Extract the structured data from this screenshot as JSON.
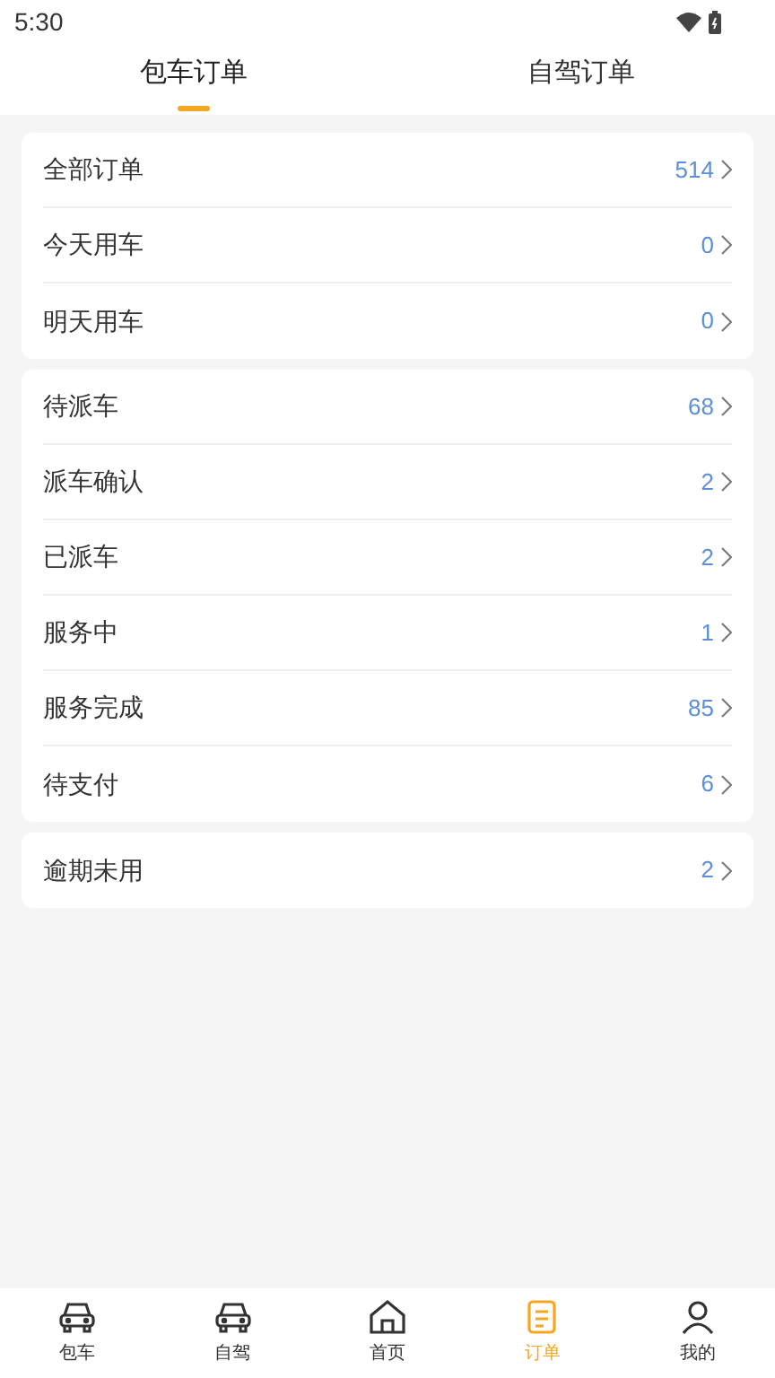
{
  "status_bar": {
    "time": "5:30"
  },
  "tabs": [
    {
      "label": "包车订单",
      "selected": true
    },
    {
      "label": "自驾订单",
      "selected": false
    }
  ],
  "groups": [
    {
      "rows": [
        {
          "label": "全部订单",
          "count": "514"
        },
        {
          "label": "今天用车",
          "count": "0"
        },
        {
          "label": "明天用车",
          "count": "0"
        }
      ]
    },
    {
      "rows": [
        {
          "label": "待派车",
          "count": "68"
        },
        {
          "label": "派车确认",
          "count": "2"
        },
        {
          "label": "已派车",
          "count": "2"
        },
        {
          "label": "服务中",
          "count": "1"
        },
        {
          "label": "服务完成",
          "count": "85"
        },
        {
          "label": "待支付",
          "count": "6"
        }
      ]
    },
    {
      "rows": [
        {
          "label": "逾期未用",
          "count": "2"
        }
      ]
    }
  ],
  "bottom_nav": [
    {
      "label": "包车",
      "kind": "car",
      "selected": false
    },
    {
      "label": "自驾",
      "kind": "car",
      "selected": false
    },
    {
      "label": "首页",
      "kind": "home",
      "selected": false
    },
    {
      "label": "订单",
      "kind": "orders",
      "selected": true
    },
    {
      "label": "我的",
      "kind": "person",
      "selected": false
    }
  ]
}
